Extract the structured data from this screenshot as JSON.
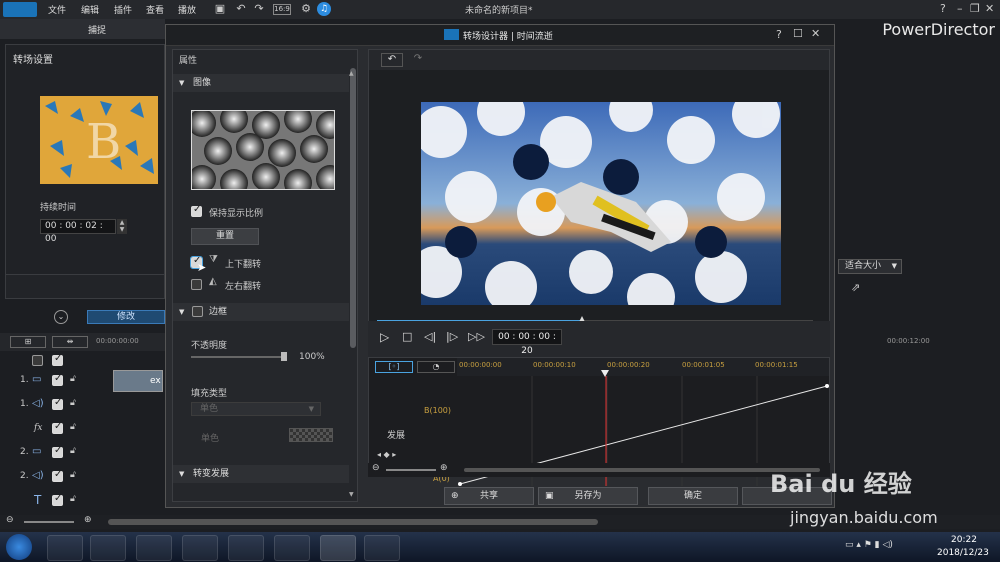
{
  "menubar": {
    "items": [
      "文件",
      "编辑",
      "插件",
      "查看",
      "播放"
    ],
    "window_title": "未命名的新项目*",
    "help": "?",
    "brand": "PowerDirector"
  },
  "left_tab": {
    "label": "捕捉"
  },
  "left_panel": {
    "title": "转场设置",
    "duration_label": "持续时间",
    "duration_value": "00 : 00 : 02 : 00",
    "thumb_letter": "B"
  },
  "modify_button": "修改",
  "timeline_main": {
    "ruler_start": "00:00:00:00",
    "ruler_end": "00:00:12:00",
    "clip_label": "ex",
    "tracks": [
      {
        "num": "1."
      },
      {
        "num": "1."
      },
      {
        "num": "fx"
      },
      {
        "num": "2."
      },
      {
        "num": "2."
      },
      {
        "num": "T"
      }
    ]
  },
  "right_controls": {
    "fit_label": "适合大小"
  },
  "dialog": {
    "title": "转场设计器 | 时间流逝",
    "help": "?",
    "properties": {
      "title": "属性",
      "image_section": "图像",
      "keep_ratio": "保持显示比例",
      "reset": "重置",
      "flip_vertical": "上下翻转",
      "flip_horizontal": "左右翻转",
      "border_section": "边框",
      "opacity_label": "不透明度",
      "opacity_value": "100%",
      "fill_type_label": "填充类型",
      "fill_type_value": "单色",
      "color_label": "单色",
      "transition_section": "转变发展",
      "keep_ratio_checked": true,
      "flip_vertical_checked": true,
      "flip_horizontal_checked": false,
      "border_checked": false
    },
    "preview": {
      "timecode": "00 : 00 : 00 : 20",
      "progress": 0.47
    },
    "keyframe": {
      "ruler": [
        "00:00:00:00",
        "00:00:00:10",
        "00:00:00:20",
        "00:00:01:05",
        "00:00:01:15"
      ],
      "track_label": "发展",
      "top_label": "B(100)",
      "bottom_label": "A(0)"
    },
    "buttons": {
      "share": "共享",
      "save_as": "另存为",
      "ok": "确定"
    }
  },
  "taskbar": {
    "time": "20:22",
    "date": "2018/12/23"
  },
  "watermark": {
    "logo": "Bai du 经验",
    "url": "jingyan.baidu.com"
  },
  "colors": {
    "accent": "#4aa3e0",
    "playhead": "#e03030",
    "dialog_bg": "#2a2c30"
  }
}
